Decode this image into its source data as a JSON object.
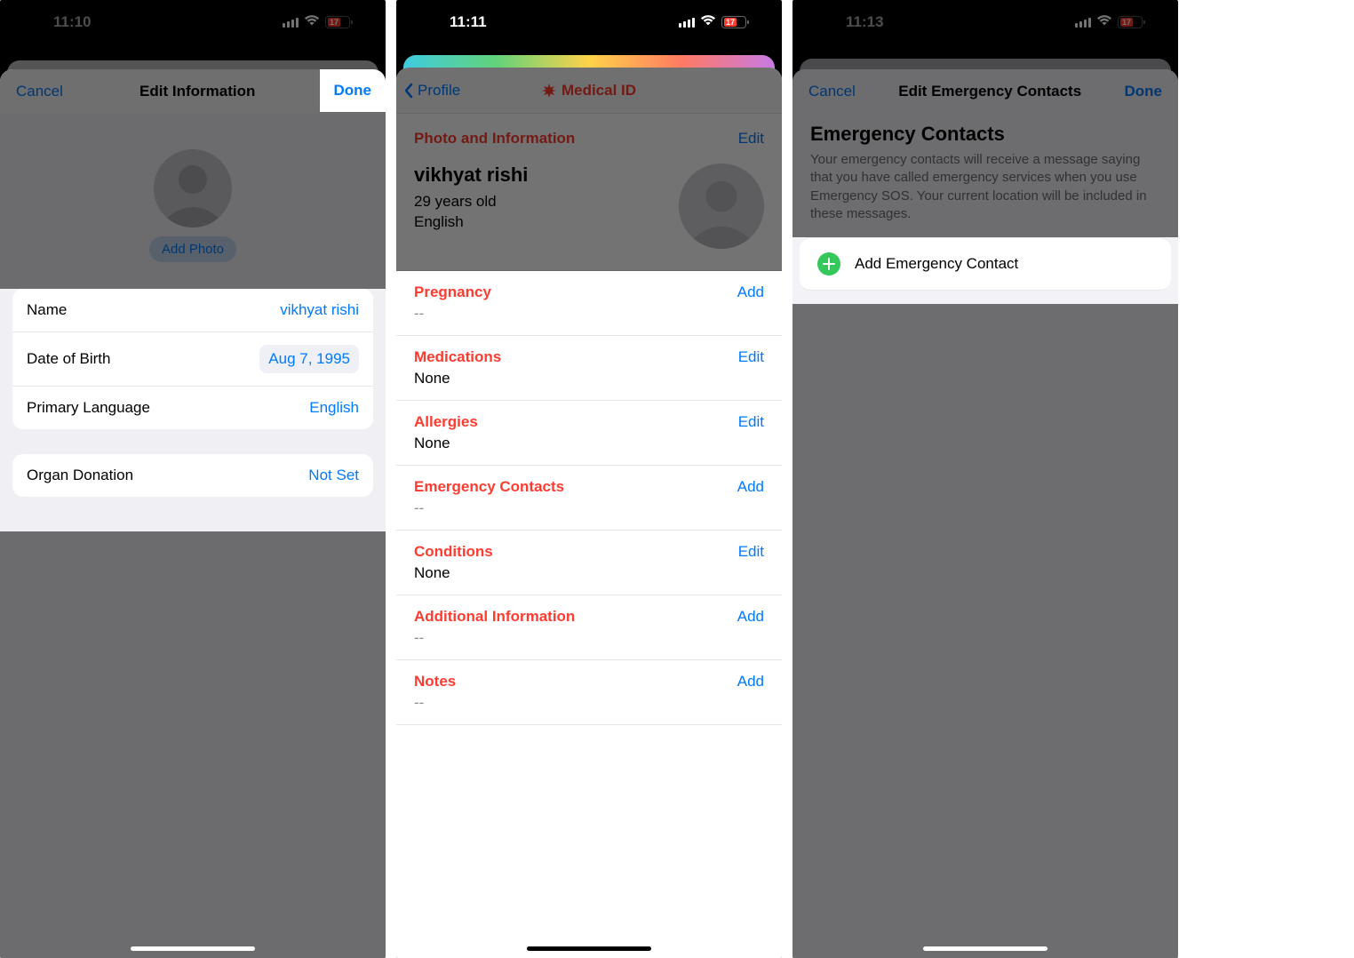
{
  "screen1": {
    "status_time": "11:10",
    "battery": "17",
    "nav": {
      "cancel": "Cancel",
      "title": "Edit Information",
      "done": "Done"
    },
    "add_photo": "Add Photo",
    "rows": {
      "name_label": "Name",
      "name_value": "vikhyat rishi",
      "dob_label": "Date of Birth",
      "dob_value": "Aug 7, 1995",
      "lang_label": "Primary Language",
      "lang_value": "English",
      "organ_label": "Organ Donation",
      "organ_value": "Not Set"
    }
  },
  "screen2": {
    "status_time": "11:11",
    "battery": "17",
    "back": "Profile",
    "title": "Medical ID",
    "header": {
      "section": "Photo and Information",
      "edit": "Edit",
      "name": "vikhyat rishi",
      "age": "29 years old",
      "language": "English"
    },
    "sections": [
      {
        "title": "Pregnancy",
        "action": "Add",
        "value": "--",
        "dash": true
      },
      {
        "title": "Medications",
        "action": "Edit",
        "value": "None",
        "dash": false
      },
      {
        "title": "Allergies",
        "action": "Edit",
        "value": "None",
        "dash": false
      },
      {
        "title": "Emergency Contacts",
        "action": "Add",
        "value": "--",
        "dash": true
      },
      {
        "title": "Conditions",
        "action": "Edit",
        "value": "None",
        "dash": false
      },
      {
        "title": "Additional Information",
        "action": "Add",
        "value": "--",
        "dash": true
      },
      {
        "title": "Notes",
        "action": "Add",
        "value": "--",
        "dash": true
      }
    ]
  },
  "screen3": {
    "status_time": "11:13",
    "battery": "17",
    "nav": {
      "cancel": "Cancel",
      "title": "Edit Emergency Contacts",
      "done": "Done"
    },
    "heading": "Emergency Contacts",
    "description": "Your emergency contacts will receive a message saying that you have called emergency services when you use Emergency SOS. Your current location will be included in these messages.",
    "add_row": "Add Emergency Contact"
  }
}
